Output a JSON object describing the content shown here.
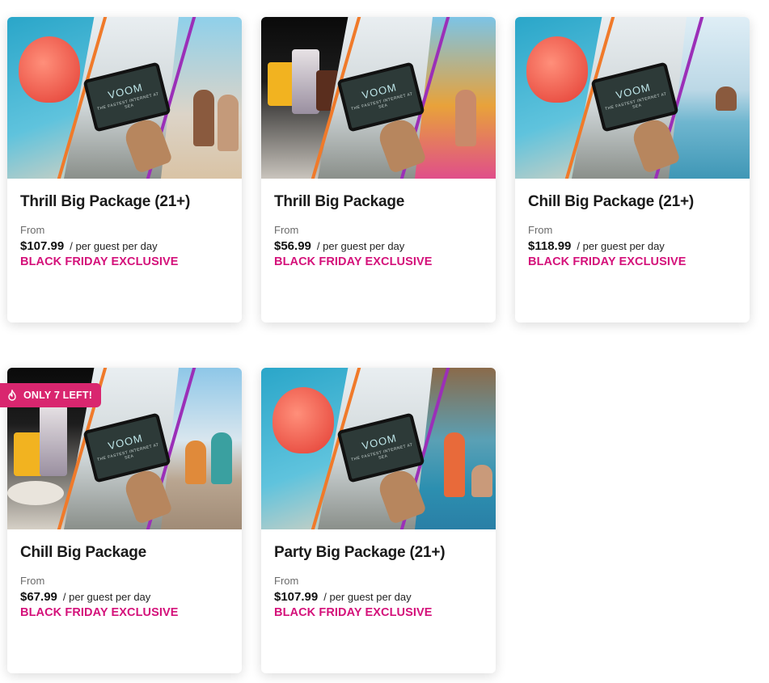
{
  "badge": {
    "label": "ONLY 7 LEFT!",
    "icon": "flame-icon",
    "color": "#d9266f"
  },
  "theme": {
    "promo_color": "#d4117a",
    "stripe_orange": "#f07a2a",
    "stripe_purple": "#9b2fb8"
  },
  "tablet": {
    "brand": "VOOM",
    "tagline": "THE FASTEST INTERNET AT SEA"
  },
  "cards": [
    {
      "title": "Thrill Big Package (21+)",
      "from_label": "From",
      "price": "$107.99",
      "unit": "/ per guest per day",
      "promo": "BLACK FRIDAY EXCLUSIVE"
    },
    {
      "title": "Thrill Big Package",
      "from_label": "From",
      "price": "$56.99",
      "unit": "/ per guest per day",
      "promo": "BLACK FRIDAY EXCLUSIVE"
    },
    {
      "title": "Chill Big Package (21+)",
      "from_label": "From",
      "price": "$118.99",
      "unit": "/ per guest per day",
      "promo": "BLACK FRIDAY EXCLUSIVE"
    },
    {
      "title": "Chill Big Package",
      "from_label": "From",
      "price": "$67.99",
      "unit": "/ per guest per day",
      "promo": "BLACK FRIDAY EXCLUSIVE"
    },
    {
      "title": "Party Big Package (21+)",
      "from_label": "From",
      "price": "$107.99",
      "unit": "/ per guest per day",
      "promo": "BLACK FRIDAY EXCLUSIVE"
    }
  ]
}
